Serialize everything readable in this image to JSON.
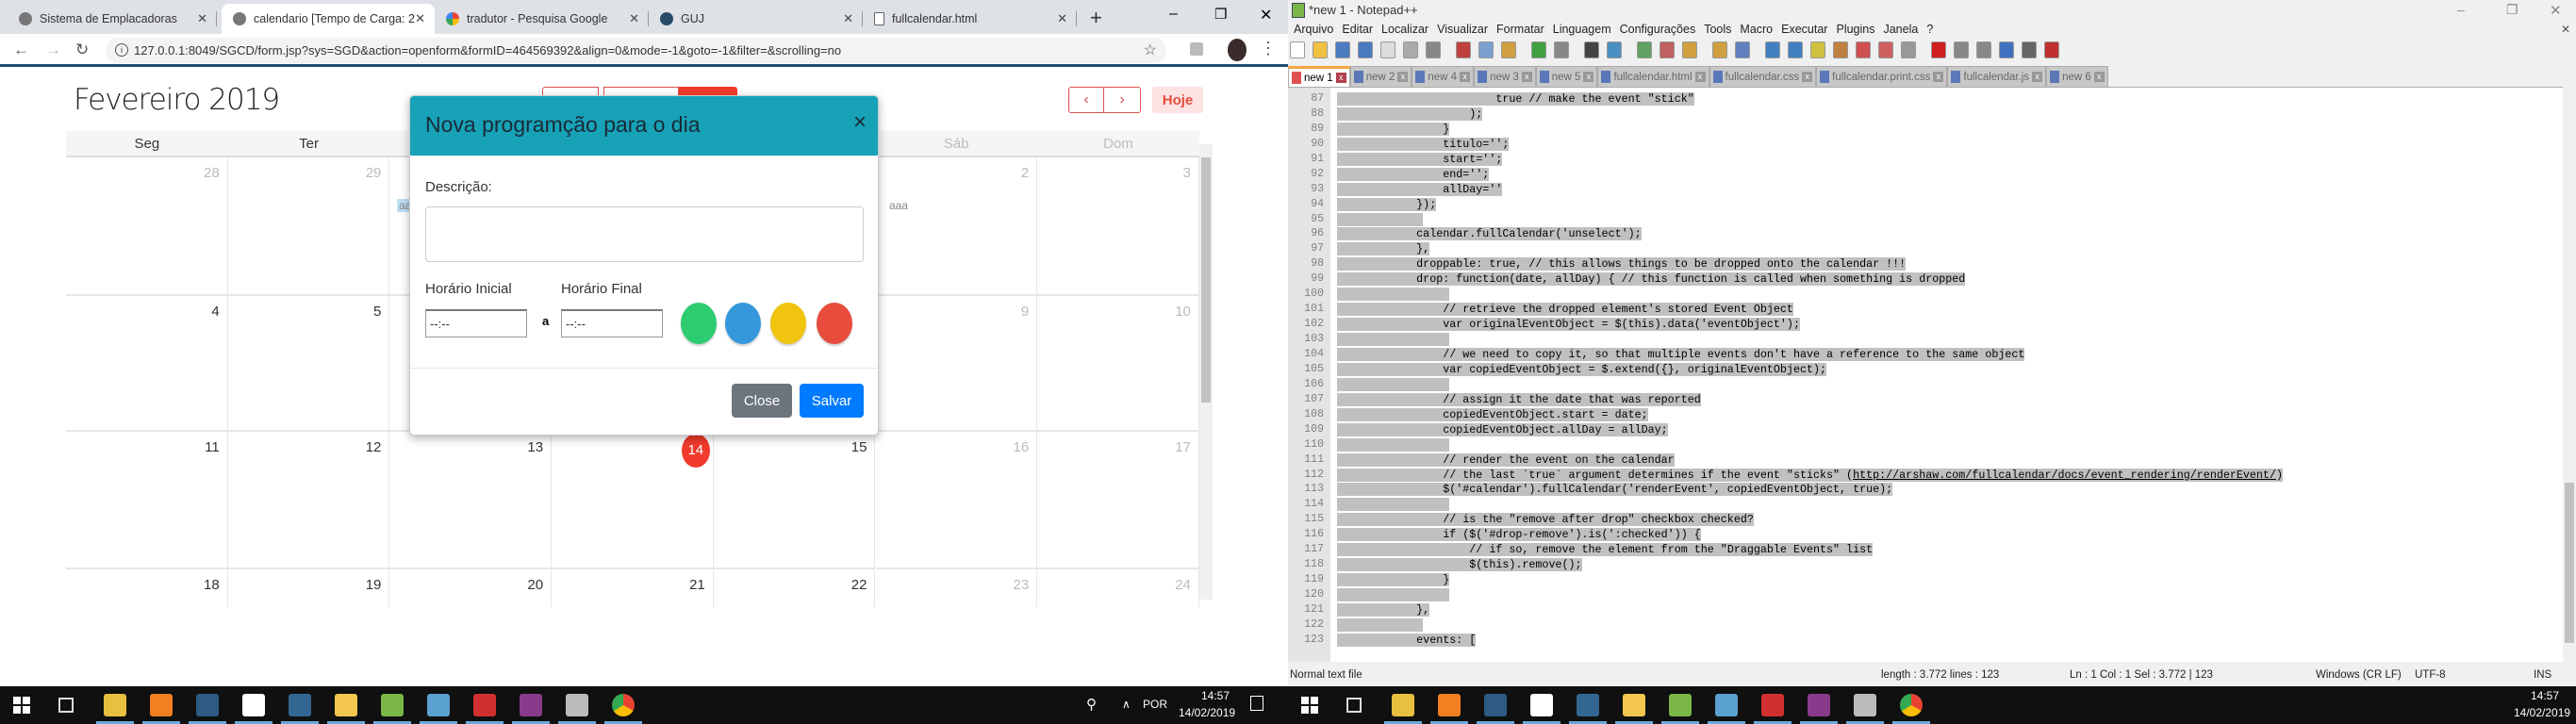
{
  "chrome": {
    "tabs": [
      {
        "label": "Sistema de Emplacadoras",
        "icon": "spinner-icon"
      },
      {
        "label": "calendario [Tempo de Carga: 2",
        "icon": "spinner-icon",
        "active": true
      },
      {
        "label": "tradutor - Pesquisa Google",
        "icon": "google-icon"
      },
      {
        "label": "GUJ",
        "icon": "guj-icon"
      },
      {
        "label": "fullcalendar.html",
        "icon": "file-icon"
      }
    ],
    "new_tab": "+",
    "url": "127.0.0.1:8049/SGCD/form.jsp?sys=SGD&action=openform&formID=464569392&align=0&mode=-1&goto=-1&filter=&scrolling=no"
  },
  "calendar": {
    "title": "Fevereiro 2019",
    "prev": "‹",
    "next": "›",
    "today": "Hoje",
    "weekdays": [
      "Seg",
      "Ter",
      "",
      "",
      "",
      "Sáb",
      "Dom"
    ],
    "rows": [
      [
        "28",
        "29",
        "",
        "",
        "",
        "2",
        "3"
      ],
      [
        "4",
        "5",
        "",
        "",
        "",
        "9",
        "10"
      ],
      [
        "11",
        "12",
        "13",
        "14",
        "15",
        "16",
        "17"
      ],
      [
        "18",
        "19",
        "20",
        "21",
        "22",
        "23",
        "24"
      ]
    ],
    "events": {
      "wed_row1": "aa",
      "sat_row1": "aaa"
    },
    "today_color": "#f23a2c"
  },
  "modal": {
    "title": "Nova programção para o dia",
    "close_x": "×",
    "description_label": "Descrição:",
    "start_label": "Horário Inicial",
    "end_label": "Horário Final",
    "start_value": "--:--",
    "end_value": "--:--",
    "separator": "a",
    "colors": [
      "#2ecc71",
      "#3498db",
      "#f1c40f",
      "#e74c3c"
    ],
    "close_button": "Close",
    "save_button": "Salvar",
    "header_color": "#17a2b8"
  },
  "taskbar_left": {
    "language": "POR",
    "time": "14:57",
    "date": "14/02/2019"
  },
  "taskbar_right": {
    "time": "14:57",
    "date": "14/02/2019"
  },
  "notepad": {
    "title": "*new 1 - Notepad++",
    "menu": [
      "Arquivo",
      "Editar",
      "Localizar",
      "Visualizar",
      "Formatar",
      "Linguagem",
      "Configurações",
      "Tools",
      "Macro",
      "Executar",
      "Plugins",
      "Janela",
      "?"
    ],
    "tabs": [
      "new 1",
      "new 2",
      "new 4",
      "new 3",
      "new 5",
      "fullcalendar.html",
      "fullcalendar.css",
      "fullcalendar.print.css",
      "fullcalendar.js",
      "new 6"
    ],
    "lines": [
      {
        "n": "87",
        "t": "\t\t\t\t\t\ttrue // make the event \"stick\""
      },
      {
        "n": "88",
        "t": "\t\t\t\t\t);"
      },
      {
        "n": "89",
        "t": "\t\t\t\t}"
      },
      {
        "n": "90",
        "t": "\t\t\t\ttitulo='';"
      },
      {
        "n": "91",
        "t": "\t\t\t\tstart='';"
      },
      {
        "n": "92",
        "t": "\t\t\t\tend='';"
      },
      {
        "n": "93",
        "t": "\t\t\t\tallDay=''"
      },
      {
        "n": "94",
        "t": "\t\t\t});"
      },
      {
        "n": "95",
        "t": "\t\t\t "
      },
      {
        "n": "96",
        "t": "\t\t\tcalendar.fullCalendar('unselect');"
      },
      {
        "n": "97",
        "t": "\t\t\t},"
      },
      {
        "n": "98",
        "t": "\t\t\tdroppable: true, // this allows things to be dropped onto the calendar !!!"
      },
      {
        "n": "99",
        "t": "\t\t\tdrop: function(date, allDay) { // this function is called when something is dropped"
      },
      {
        "n": "100",
        "t": "\t\t\t\t "
      },
      {
        "n": "101",
        "t": "\t\t\t\t// retrieve the dropped element's stored Event Object"
      },
      {
        "n": "102",
        "t": "\t\t\t\tvar originalEventObject = $(this).data('eventObject');"
      },
      {
        "n": "103",
        "t": "\t\t\t\t "
      },
      {
        "n": "104",
        "t": "\t\t\t\t// we need to copy it, so that multiple events don't have a reference to the same object"
      },
      {
        "n": "105",
        "t": "\t\t\t\tvar copiedEventObject = $.extend({}, originalEventObject);"
      },
      {
        "n": "106",
        "t": "\t\t\t\t "
      },
      {
        "n": "107",
        "t": "\t\t\t\t// assign it the date that was reported"
      },
      {
        "n": "108",
        "t": "\t\t\t\tcopiedEventObject.start = date;"
      },
      {
        "n": "109",
        "t": "\t\t\t\tcopiedEventObject.allDay = allDay;"
      },
      {
        "n": "110",
        "t": "\t\t\t\t "
      },
      {
        "n": "111",
        "t": "\t\t\t\t// render the event on the calendar"
      },
      {
        "n": "112",
        "t": "\t\t\t\t// the last `true` argument determines if the event \"sticks\" (",
        "url": "http://arshaw.com/fullcalendar/docs/event_rendering/renderEvent/",
        "after": ")"
      },
      {
        "n": "113",
        "t": "\t\t\t\t$('#calendar').fullCalendar('renderEvent', copiedEventObject, true);"
      },
      {
        "n": "114",
        "t": "\t\t\t\t "
      },
      {
        "n": "115",
        "t": "\t\t\t\t// is the \"remove after drop\" checkbox checked?"
      },
      {
        "n": "116",
        "t": "\t\t\t\tif ($('#drop-remove').is(':checked')) {"
      },
      {
        "n": "117",
        "t": "\t\t\t\t\t// if so, remove the element from the \"Draggable Events\" list"
      },
      {
        "n": "118",
        "t": "\t\t\t\t\t$(this).remove();"
      },
      {
        "n": "119",
        "t": "\t\t\t\t}"
      },
      {
        "n": "120",
        "t": "\t\t\t\t "
      },
      {
        "n": "121",
        "t": "\t\t\t},"
      },
      {
        "n": "122",
        "t": "\t\t\t "
      },
      {
        "n": "123",
        "t": "\t\t\tevents: ["
      }
    ],
    "status": {
      "type": "Normal text file",
      "length": "length : 3.772    lines : 123",
      "position": "Ln : 1    Col : 1    Sel : 3.772 | 123",
      "eol": "Windows (CR LF)",
      "encoding": "UTF-8",
      "mode": "INS"
    }
  }
}
